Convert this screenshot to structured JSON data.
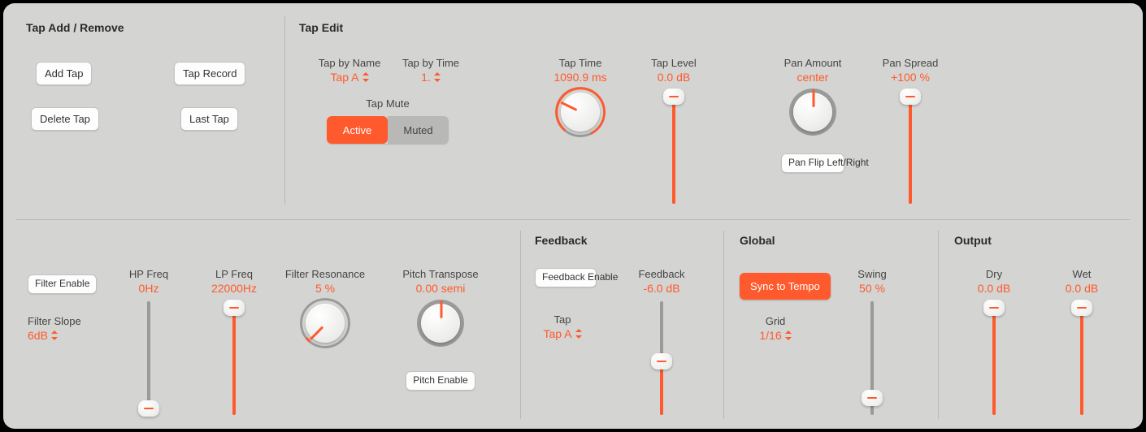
{
  "colors": {
    "accent": "#ff5a2d"
  },
  "tap_add_remove": {
    "title": "Tap Add / Remove",
    "buttons": {
      "add_tap": "Add Tap",
      "tap_record": "Tap Record",
      "delete_tap": "Delete Tap",
      "last_tap": "Last Tap"
    }
  },
  "tap_edit": {
    "title": "Tap Edit",
    "tap_by_name": {
      "label": "Tap by Name",
      "value": "Tap A"
    },
    "tap_by_time": {
      "label": "Tap by Time",
      "value": "1."
    },
    "tap_mute": {
      "label": "Tap Mute",
      "active": "Active",
      "muted": "Muted",
      "selected": "Active"
    },
    "tap_time": {
      "label": "Tap Time",
      "value": "1090.9 ms",
      "norm": 0.9
    },
    "tap_level": {
      "label": "Tap Level",
      "value": "0.0 dB",
      "norm": 1.0
    },
    "pan_amount": {
      "label": "Pan Amount",
      "value": "center",
      "norm": 0.5
    },
    "pan_spread": {
      "label": "Pan Spread",
      "value": "+100 %",
      "norm": 1.0
    },
    "pan_flip": {
      "label": "Pan Flip Left/Right"
    }
  },
  "filter": {
    "filter_enable": {
      "label": "Filter Enable"
    },
    "filter_slope": {
      "label": "Filter Slope",
      "value": "6dB"
    },
    "hp_freq": {
      "label": "HP Freq",
      "value": "0Hz",
      "norm": 0.0
    },
    "lp_freq": {
      "label": "LP Freq",
      "value": "22000Hz",
      "norm": 1.0
    },
    "filter_resonance": {
      "label": "Filter Resonance",
      "value": "5 %",
      "norm": 0.05
    },
    "pitch_transpose": {
      "label": "Pitch Transpose",
      "value": "0.00 semi",
      "norm": 0.5
    },
    "pitch_enable": {
      "label": "Pitch Enable"
    }
  },
  "feedback": {
    "title": "Feedback",
    "feedback_enable": {
      "label": "Feedback Enable"
    },
    "tap": {
      "label": "Tap",
      "value": "Tap A"
    },
    "feedback": {
      "label": "Feedback",
      "value": "-6.0 dB",
      "norm": 0.47
    }
  },
  "global": {
    "title": "Global",
    "sync_to_tempo": {
      "label": "Sync to Tempo"
    },
    "grid": {
      "label": "Grid",
      "value": "1/16"
    },
    "swing": {
      "label": "Swing",
      "value": "50 %",
      "norm": 0.15
    }
  },
  "output": {
    "title": "Output",
    "dry": {
      "label": "Dry",
      "value": "0.0 dB",
      "norm": 1.0
    },
    "wet": {
      "label": "Wet",
      "value": "0.0 dB",
      "norm": 1.0
    }
  }
}
